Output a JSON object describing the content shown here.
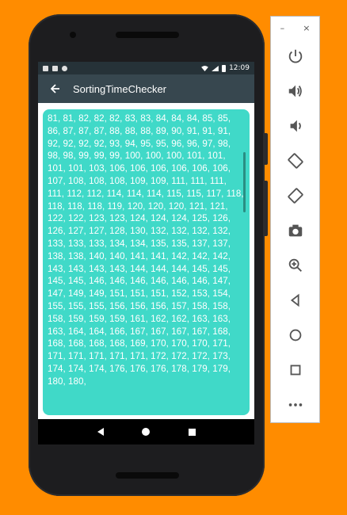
{
  "status_bar": {
    "time": "12:09"
  },
  "app_bar": {
    "title": "SortingTimeChecker"
  },
  "content": {
    "numbers": "81, 81, 82, 82, 82, 83, 83, 84, 84, 84, 85, 85, 86, 87, 87, 87, 88, 88, 88, 89, 90, 91, 91, 91, 92, 92, 92, 92, 93, 94, 95, 95, 96, 96, 97, 98, 98, 98, 99, 99, 99, 100, 100, 100, 101, 101, 101, 101, 103, 106, 106, 106, 106, 106, 106, 107, 108, 108, 108, 109, 109, 111, 111, 111, 111, 112, 112, 114, 114, 114, 115, 115, 117, 118, 118, 118, 118, 119, 120, 120, 120, 121, 121, 122, 122, 123, 123, 124, 124, 124, 125, 126, 126, 127, 127, 128, 130, 132, 132, 132, 132, 133, 133, 133, 134, 134, 135, 135, 137, 137, 138, 138, 140, 140, 141, 141, 142, 142, 142, 143, 143, 143, 143, 144, 144, 144, 145, 145, 145, 145, 146, 146, 146, 146, 146, 146, 147, 147, 149, 149, 151, 151, 151, 152, 153, 154, 155, 155, 155, 156, 156, 156, 157, 158, 158, 158, 159, 159, 159, 161, 162, 162, 163, 163, 163, 164, 164, 166, 167, 167, 167, 167, 168, 168, 168, 168, 168, 169, 170, 170, 170, 171, 171, 171, 171, 171, 171, 172, 172, 172, 173, 174, 174, 174, 176, 176, 176, 178, 179, 179, 180, 180,"
  },
  "colors": {
    "page_background": "#FF8C00",
    "toolbar": "#37474F",
    "status_bar": "#263238",
    "content_card": "#40D9C8",
    "text": "#FFFFFF"
  },
  "emulator_panel": {
    "minimize": "–",
    "close": "×",
    "icons": [
      "power-icon",
      "volume-up-icon",
      "volume-down-icon",
      "rotate-left-icon",
      "rotate-right-icon",
      "camera-icon",
      "zoom-icon",
      "back-icon",
      "home-icon",
      "overview-icon",
      "more-icon"
    ]
  }
}
